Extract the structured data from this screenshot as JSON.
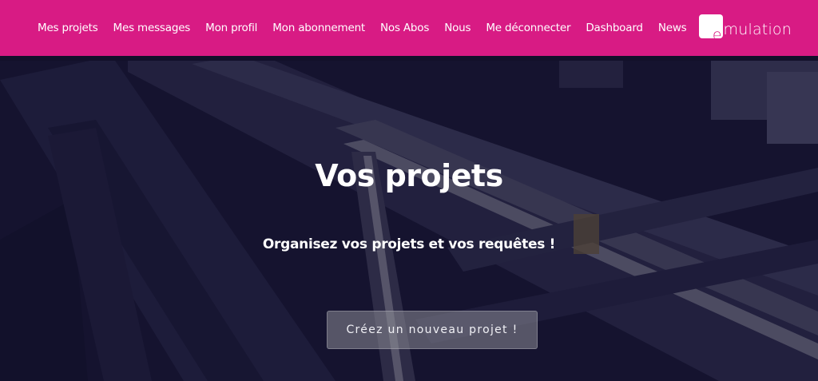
{
  "nav": {
    "items": [
      {
        "label": "Mes projets"
      },
      {
        "label": "Mes messages"
      },
      {
        "label": "Mon profil"
      },
      {
        "label": "Mon abonnement"
      },
      {
        "label": "Nos Abos"
      },
      {
        "label": "Nous"
      },
      {
        "label": "Me déconnecter"
      },
      {
        "label": "Dashboard"
      },
      {
        "label": "News"
      }
    ]
  },
  "logo": {
    "mark": "e",
    "text": "mulation"
  },
  "hero": {
    "title": "Vos projets",
    "subtitle": "Organisez vos projets et vos requêtes !",
    "cta_label": "Créez un nouveau projet !"
  },
  "colors": {
    "brand": "#d81b84",
    "hero_bg": "#15142e",
    "button_bg": "#6e6e7a"
  }
}
